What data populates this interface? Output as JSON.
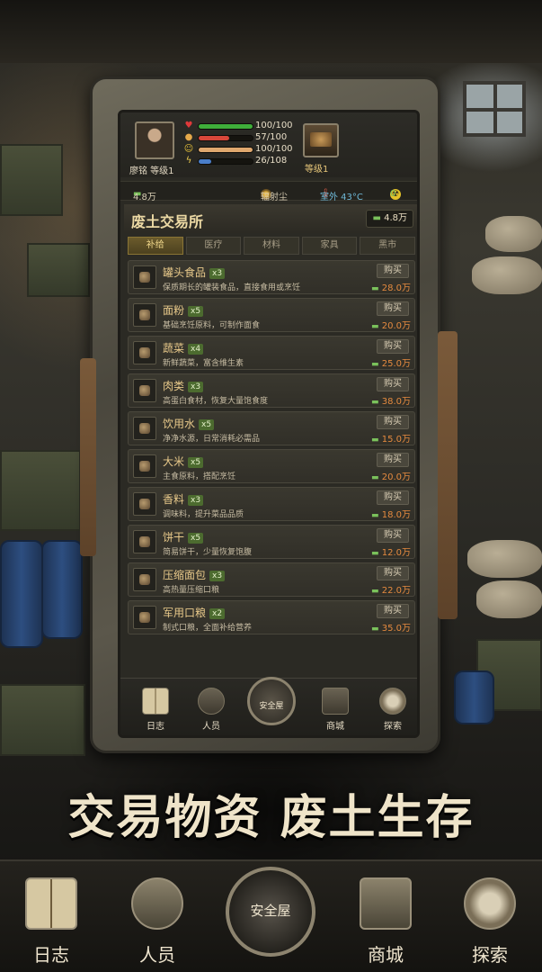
{
  "player": {
    "name_level": "廖铭 等级1",
    "stats": [
      {
        "name": "health",
        "icon": "heart-icon",
        "current": 100,
        "max": 100,
        "text": "100/100",
        "color": "#3fae3a"
      },
      {
        "name": "hunger",
        "icon": "food-icon",
        "current": 57,
        "max": 100,
        "text": "57/100",
        "color": "#d8473a"
      },
      {
        "name": "mood",
        "icon": "smile-icon",
        "current": 100,
        "max": 100,
        "text": "100/100",
        "color": "#e0a86e"
      },
      {
        "name": "energy",
        "icon": "lightning-icon",
        "current": 26,
        "max": 108,
        "text": "26/108",
        "color": "#4a7ec9"
      }
    ]
  },
  "shelter": {
    "level": "等级1"
  },
  "info": {
    "money": "4.8万",
    "radiation": "辐射尘",
    "temperature": "室外 43°C",
    "nuke": "0"
  },
  "market": {
    "title": "废土交易所",
    "money": "4.8万",
    "tabs": [
      "补给",
      "医疗",
      "材料",
      "家具",
      "黑市"
    ],
    "active_tab": 0,
    "items": [
      {
        "name": "罐头食品",
        "qty": "x3",
        "desc": "保质期长的罐装食品，直接食用或烹饪",
        "buy": "购买",
        "price": "28.0万"
      },
      {
        "name": "面粉",
        "qty": "x5",
        "desc": "基础烹饪原料，可制作面食",
        "buy": "购买",
        "price": "20.0万"
      },
      {
        "name": "蔬菜",
        "qty": "x4",
        "desc": "新鲜蔬菜，富含维生素",
        "buy": "购买",
        "price": "25.0万"
      },
      {
        "name": "肉类",
        "qty": "x3",
        "desc": "高蛋白食材，恢复大量饱食度",
        "buy": "购买",
        "price": "38.0万"
      },
      {
        "name": "饮用水",
        "qty": "x5",
        "desc": "净净水源，日常消耗必需品",
        "buy": "购买",
        "price": "15.0万"
      },
      {
        "name": "大米",
        "qty": "x5",
        "desc": "主食原料，搭配烹饪",
        "buy": "购买",
        "price": "20.0万"
      },
      {
        "name": "香料",
        "qty": "x3",
        "desc": "调味料，提升菜品品质",
        "buy": "购买",
        "price": "18.0万"
      },
      {
        "name": "饼干",
        "qty": "x5",
        "desc": "简易饼干，少量恢复饱腹",
        "buy": "购买",
        "price": "12.0万"
      },
      {
        "name": "压缩面包",
        "qty": "x3",
        "desc": "高热量压缩口粮",
        "buy": "购买",
        "price": "22.0万"
      },
      {
        "name": "军用口粮",
        "qty": "x2",
        "desc": "制式口粮，全面补给营养",
        "buy": "购买",
        "price": "35.0万"
      }
    ]
  },
  "inner_nav": {
    "log": "日志",
    "people": "人员",
    "shelter": "安全屋",
    "shop": "商城",
    "explore": "探索"
  },
  "slogan": "交易物资 废土生存",
  "outer_nav": {
    "log": "日志",
    "people": "人员",
    "shelter": "安全屋",
    "shop": "商城",
    "explore": "探索"
  }
}
